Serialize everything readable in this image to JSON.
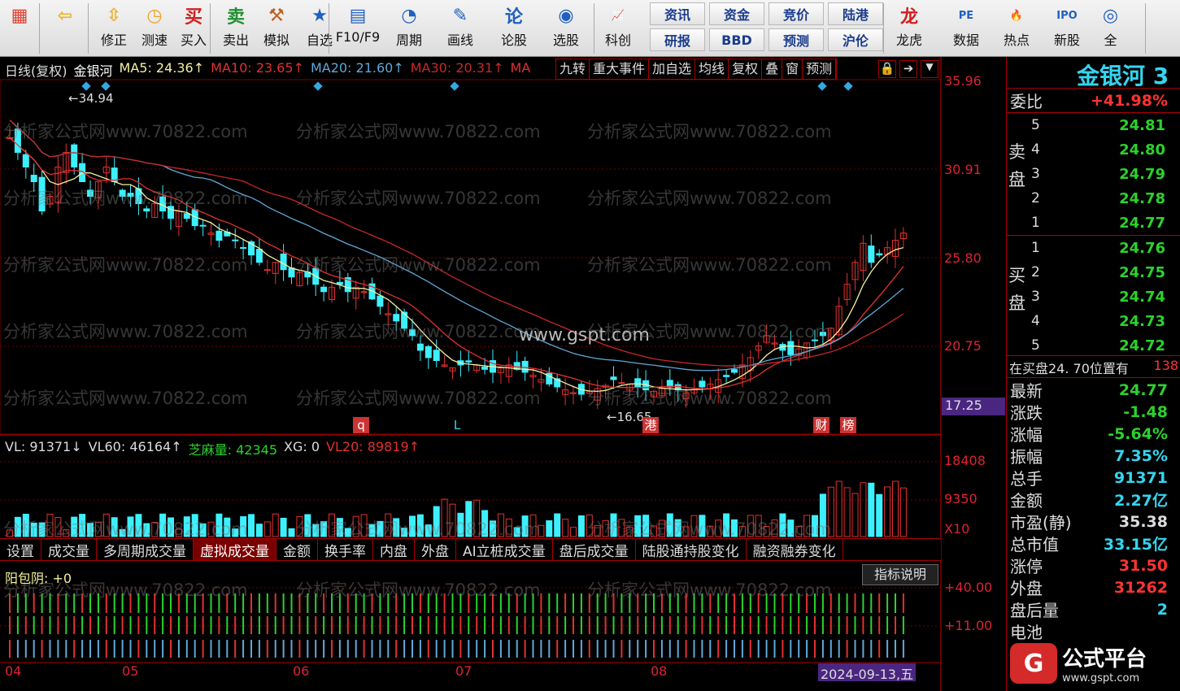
{
  "toolbar": {
    "buttons": [
      {
        "label": "",
        "icon": "windows-icon"
      },
      {
        "label": "",
        "icon": "back-arrow-icon"
      },
      {
        "label": "修正",
        "icon": "up-down-arrow-icon"
      },
      {
        "label": "测速",
        "icon": "clock-icon"
      },
      {
        "label": "买入",
        "icon": "buy-icon",
        "glyph": "买"
      },
      {
        "label": "卖出",
        "icon": "sell-icon",
        "glyph": "卖"
      },
      {
        "label": "模拟",
        "icon": "hammer-icon"
      },
      {
        "label": "自选",
        "icon": "star-icon"
      },
      {
        "label": "F10/F9",
        "icon": "f10-icon"
      },
      {
        "label": "周期",
        "icon": "period-icon"
      },
      {
        "label": "画线",
        "icon": "pen-icon"
      },
      {
        "label": "论股",
        "icon": "discuss-icon"
      },
      {
        "label": "选股",
        "icon": "screen-icon"
      },
      {
        "label": "科创",
        "icon": "chart-icon"
      },
      {
        "label": "龙虎",
        "icon": "dragon-icon"
      },
      {
        "label": "数据",
        "icon": "pe-icon"
      },
      {
        "label": "热点",
        "icon": "hot-icon"
      },
      {
        "label": "新股",
        "icon": "ipo-icon"
      },
      {
        "label": "全",
        "icon": "globe-icon"
      }
    ],
    "grid": [
      [
        "资讯",
        "资金",
        "竞价",
        "陆港"
      ],
      [
        "研报",
        "BBD",
        "预测",
        "沪伦"
      ]
    ]
  },
  "chart_header": {
    "period": "日线(复权)",
    "name": "金银河",
    "ma5": "MA5: 24.36↑",
    "ma10": "MA10: 23.65↑",
    "ma20": "MA20: 21.60↑",
    "ma30": "MA30: 20.31↑",
    "ma": "MA",
    "tools": [
      "九转",
      "重大事件",
      "加自选",
      "均线",
      "复权",
      "叠",
      "窗",
      "预测"
    ]
  },
  "price_axis": [
    "35.96",
    "30.91",
    "25.80",
    "20.75"
  ],
  "current_price_label": "17.25",
  "annotations": {
    "high": "34.94",
    "low": "16.65",
    "event_markers": [
      "q",
      "L",
      "港",
      "财",
      "榜"
    ]
  },
  "watermark": "分析家公式网www.70822.com",
  "center_watermark": "www.gspt.com",
  "volume_header": {
    "vl": "VL: 91371↓",
    "vl60": "VL60: 46164↑",
    "zhima": "芝麻量: 42345",
    "xg": "XG: 0",
    "vl20": "VL20: 89819↑"
  },
  "volume_axis": [
    "18408",
    "9350",
    "X10"
  ],
  "tabs": [
    "设置",
    "成交量",
    "多周期成交量",
    "虚拟成交量",
    "金额",
    "换手率",
    "内盘",
    "外盘",
    "AI立桩成交量",
    "盘后成交量",
    "陆股通持股变化",
    "融资融券变化"
  ],
  "active_tab": "虚拟成交量",
  "indicator": {
    "name": "阳包阴: +0",
    "help": "指标说明",
    "axis": [
      "+40.00",
      "+11.00"
    ]
  },
  "x_axis": [
    "04",
    "05",
    "06",
    "07",
    "08"
  ],
  "date_label": "2024-09-13,五",
  "side": {
    "title": "金银河 3",
    "weibi_label": "委比",
    "weibi_value": "+41.98%",
    "sell_label": "卖盘",
    "buy_label": "买盘",
    "sell": [
      {
        "n": "5",
        "p": "24.81"
      },
      {
        "n": "4",
        "p": "24.80"
      },
      {
        "n": "3",
        "p": "24.79"
      },
      {
        "n": "2",
        "p": "24.78"
      },
      {
        "n": "1",
        "p": "24.77"
      }
    ],
    "buy": [
      {
        "n": "1",
        "p": "24.76"
      },
      {
        "n": "2",
        "p": "24.75"
      },
      {
        "n": "3",
        "p": "24.74"
      },
      {
        "n": "4",
        "p": "24.73"
      },
      {
        "n": "5",
        "p": "24.72"
      }
    ],
    "notice": "在买盘24. 70位置有",
    "notice_num": "138",
    "stats": [
      {
        "l": "最新",
        "v": "24.77",
        "c": "#2cd22c"
      },
      {
        "l": "涨跌",
        "v": "-1.48",
        "c": "#2cd22c"
      },
      {
        "l": "涨幅",
        "v": "-5.64%",
        "c": "#2cd22c"
      },
      {
        "l": "振幅",
        "v": "7.35%",
        "c": "#34d6f0"
      },
      {
        "l": "总手",
        "v": "91371",
        "c": "#34d6f0"
      },
      {
        "l": "金额",
        "v": "2.27亿",
        "c": "#34d6f0"
      },
      {
        "l": "市盈(静)",
        "v": "35.38",
        "c": "#ddd"
      },
      {
        "l": "总市值",
        "v": "33.15亿",
        "c": "#34d6f0"
      },
      {
        "l": "涨停",
        "v": "31.50",
        "c": "#f33"
      },
      {
        "l": "外盘",
        "v": "31262",
        "c": "#f33"
      },
      {
        "l": "盘后量",
        "v": "2",
        "c": "#34d6f0"
      },
      {
        "l": "电池",
        "v": "",
        "c": "#ddd"
      }
    ]
  },
  "logo": {
    "text": "公式平台",
    "url": "www.gspt.com"
  },
  "colors": {
    "up": "#e23030",
    "down": "#3cf0ff",
    "grid": "#7a0000",
    "ma5": "#f5f0a0",
    "ma10": "#e23030",
    "ma20": "#5fa8d8",
    "ma30": "#c62828"
  }
}
